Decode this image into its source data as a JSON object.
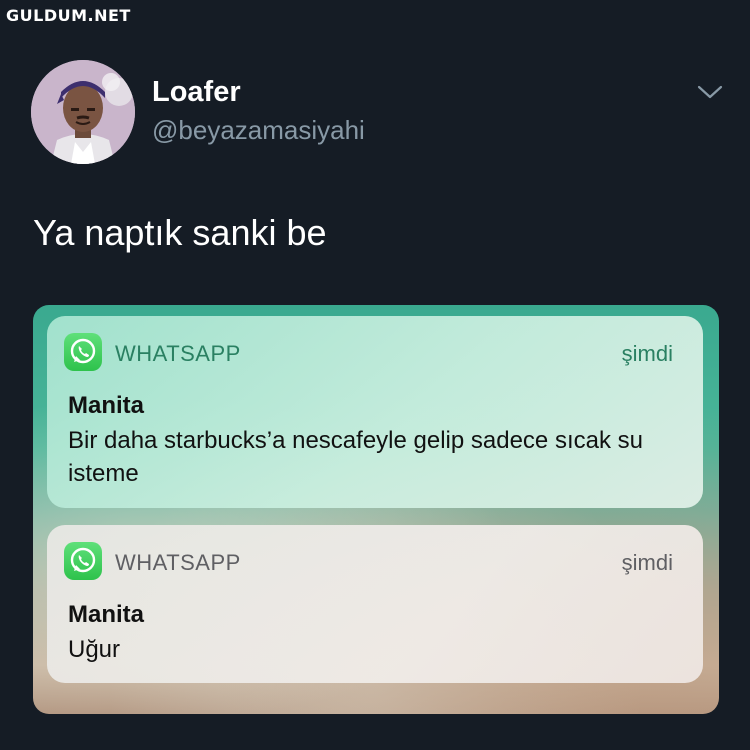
{
  "watermark": "GULDUM.NET",
  "tweet": {
    "display_name": "Loafer",
    "handle": "@beyazamasiyahi",
    "text": "Ya naptık sanki be",
    "menu_icon": "chevron-down-icon"
  },
  "notifications": [
    {
      "app_name": "WHATSAPP",
      "time": "şimdi",
      "sender": "Manita",
      "message": "Bir daha starbucks’a nescafeyle gelip sadece sıcak su isteme",
      "icon": "whatsapp-icon"
    },
    {
      "app_name": "WHATSAPP",
      "time": "şimdi",
      "sender": "Manita",
      "message": "Uğur",
      "icon": "whatsapp-icon"
    }
  ],
  "colors": {
    "background": "#151c25",
    "handle": "#8899a6",
    "whatsapp_green": "#2ec24c"
  }
}
